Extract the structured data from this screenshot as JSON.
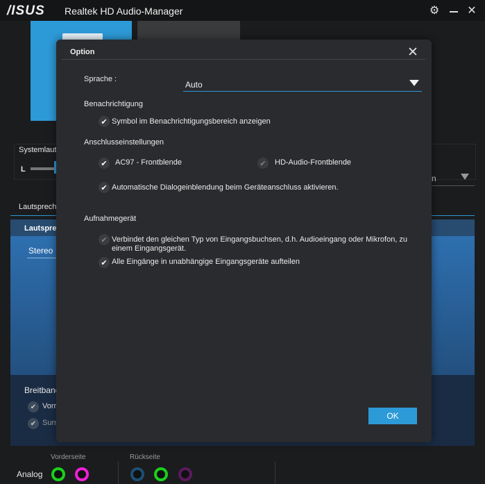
{
  "window": {
    "logo": "/ISUS",
    "title": "Realtek HD Audio-Manager"
  },
  "background": {
    "system_volume_label": "Systemlaut",
    "volume_channel_left": "L",
    "speakers_tab": "Lautsprech",
    "panel_title": "Lautspre",
    "stereo_value": "Stereo",
    "dropdown_text": "n",
    "broadband_label": "Breitband",
    "front_speaker_label": "Vorr",
    "surround_label": "Surr",
    "front_jacks_label": "Vorderseite",
    "back_jacks_label": "Rückseite",
    "analog_label": "Analog",
    "jack_colors": {
      "green": "#19d21b",
      "pink": "#f01fd8",
      "blue": "#1d4e74",
      "purple": "#5a1a5e"
    }
  },
  "dialog": {
    "title": "Option",
    "language": {
      "label": "Sprache :",
      "value": "Auto"
    },
    "notification": {
      "heading": "Benachrichtigung",
      "show_tray_icon": "Symbol im Benachrichtigungsbereich anzeigen"
    },
    "connector": {
      "heading": "Anschlusseinstellungen",
      "ac97": "AC97 - Frontblende",
      "hd_audio": "HD-Audio-Frontblende",
      "auto_popup": "Automatische Dialogeinblendung beim Geräteanschluss aktivieren."
    },
    "recording": {
      "heading": "Aufnahmegerät",
      "combine_line1": "Verbindet den gleichen Typ von Eingangsbuchsen, d.h. Audioeingang oder Mikrofon, zu",
      "combine_line2": "einem Eingangsgerät.",
      "separate_all": "Alle Eingänge in unabhängige Eingangsgeräte aufteilen"
    },
    "ok_label": "OK"
  }
}
